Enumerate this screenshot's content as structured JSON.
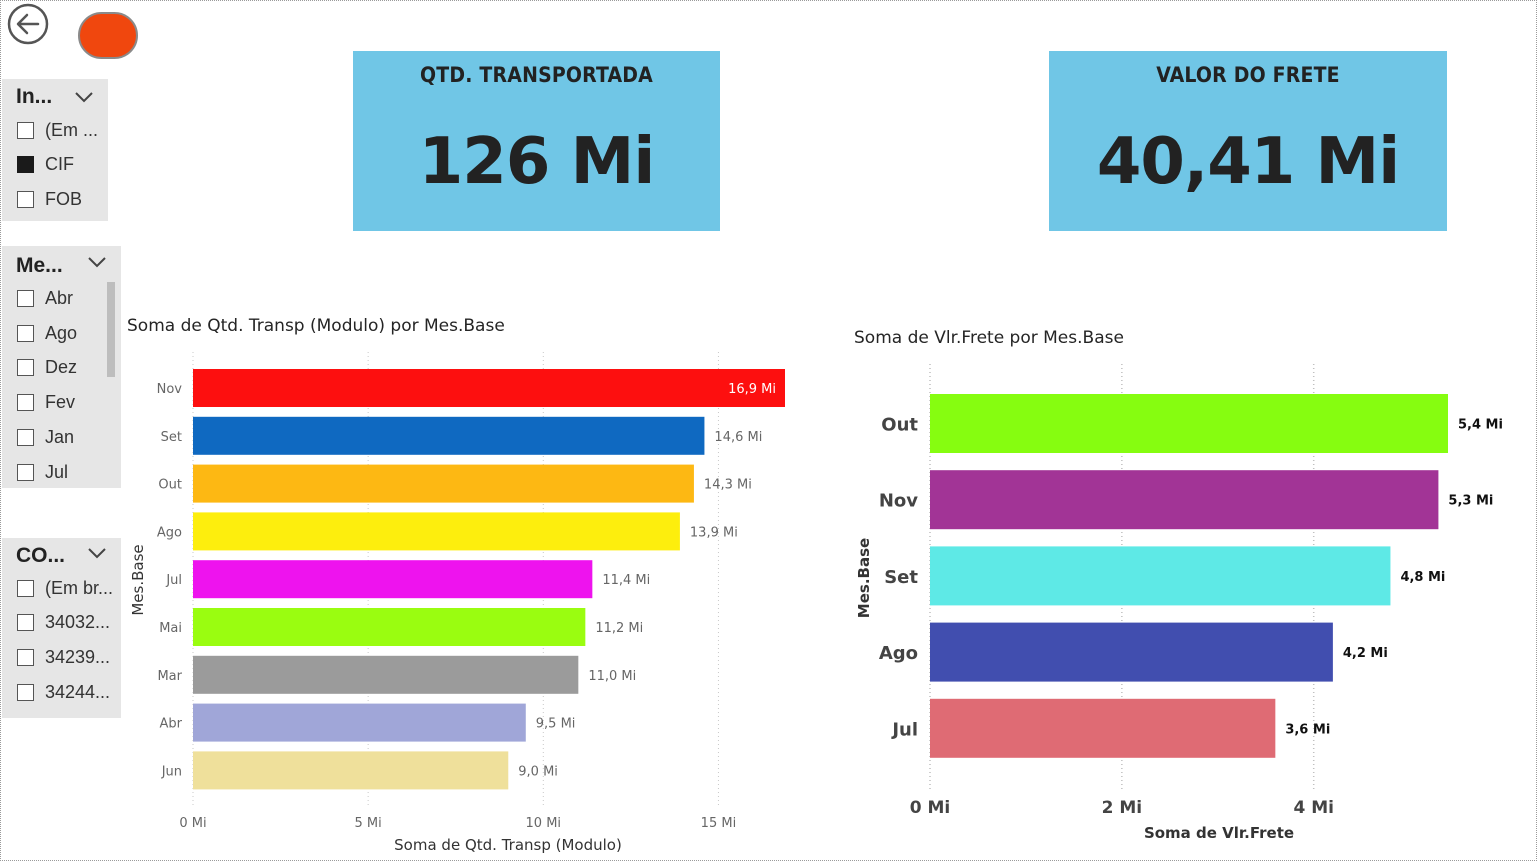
{
  "nav": {
    "back_icon": "arrow-left-circle-icon",
    "toggle_color": "#f0470e"
  },
  "slicers": [
    {
      "header": "In...",
      "items": [
        {
          "label": "(Em ...",
          "checked": false
        },
        {
          "label": "CIF",
          "checked": true
        },
        {
          "label": "FOB",
          "checked": false
        }
      ]
    },
    {
      "header": "Me...",
      "items": [
        {
          "label": "Abr",
          "checked": false
        },
        {
          "label": "Ago",
          "checked": false
        },
        {
          "label": "Dez",
          "checked": false
        },
        {
          "label": "Fev",
          "checked": false
        },
        {
          "label": "Jan",
          "checked": false
        },
        {
          "label": "Jul",
          "checked": false
        }
      ]
    },
    {
      "header": "CO...",
      "items": [
        {
          "label": "(Em br...",
          "checked": false
        },
        {
          "label": "34032...",
          "checked": false
        },
        {
          "label": "34239...",
          "checked": false
        },
        {
          "label": "34244...",
          "checked": false
        }
      ]
    }
  ],
  "cards": [
    {
      "title": "QTD. TRANSPORTADA",
      "value": "126 Mi"
    },
    {
      "title": "VALOR DO FRETE",
      "value": "40,41 Mi"
    }
  ],
  "card_color": "#70c6e6",
  "chart_data": [
    {
      "type": "bar",
      "orientation": "horizontal",
      "title": "Soma de Qtd. Transp (Modulo) por Mes.Base",
      "xlabel": "Soma de Qtd. Transp (Modulo)",
      "ylabel": "Mes.Base",
      "categories": [
        "Nov",
        "Set",
        "Out",
        "Ago",
        "Jul",
        "Mai",
        "Mar",
        "Abr",
        "Jun"
      ],
      "values": [
        16.9,
        14.6,
        14.3,
        13.9,
        11.4,
        11.2,
        11.0,
        9.5,
        9.0
      ],
      "data_labels": [
        "16,9 Mi",
        "14,6 Mi",
        "14,3 Mi",
        "13,9 Mi",
        "11,4 Mi",
        "11,2 Mi",
        "11,0 Mi",
        "9,5 Mi",
        "9,0 Mi"
      ],
      "colors": [
        "#fd0f0f",
        "#0f69c1",
        "#fdb813",
        "#fdee0d",
        "#ee13ee",
        "#9afd10",
        "#9b9b9b",
        "#a0a6d8",
        "#efe09b"
      ],
      "xlim": [
        0,
        16.9
      ],
      "xticks": [
        0,
        5,
        10,
        15
      ],
      "xtick_labels": [
        "0 Mi",
        "5 Mi",
        "10 Mi",
        "15 Mi"
      ],
      "grid": "vertical dotted"
    },
    {
      "type": "bar",
      "orientation": "horizontal",
      "title": "Soma de Vlr.Frete por Mes.Base",
      "xlabel": "Soma de Vlr.Frete",
      "ylabel": "Mes.Base",
      "categories": [
        "Out",
        "Nov",
        "Set",
        "Ago",
        "Jul"
      ],
      "values": [
        5.4,
        5.3,
        4.8,
        4.2,
        3.6
      ],
      "data_labels": [
        "5,4 Mi",
        "5,3 Mi",
        "4,8 Mi",
        "4,2 Mi",
        "3,6 Mi"
      ],
      "colors": [
        "#86fd10",
        "#a23496",
        "#5ee9e6",
        "#414eaf",
        "#df6b74"
      ],
      "xlim": [
        0,
        5.4
      ],
      "xticks": [
        0,
        2,
        4
      ],
      "xtick_labels": [
        "0 Mi",
        "2 Mi",
        "4 Mi"
      ],
      "grid": "vertical dotted"
    }
  ]
}
